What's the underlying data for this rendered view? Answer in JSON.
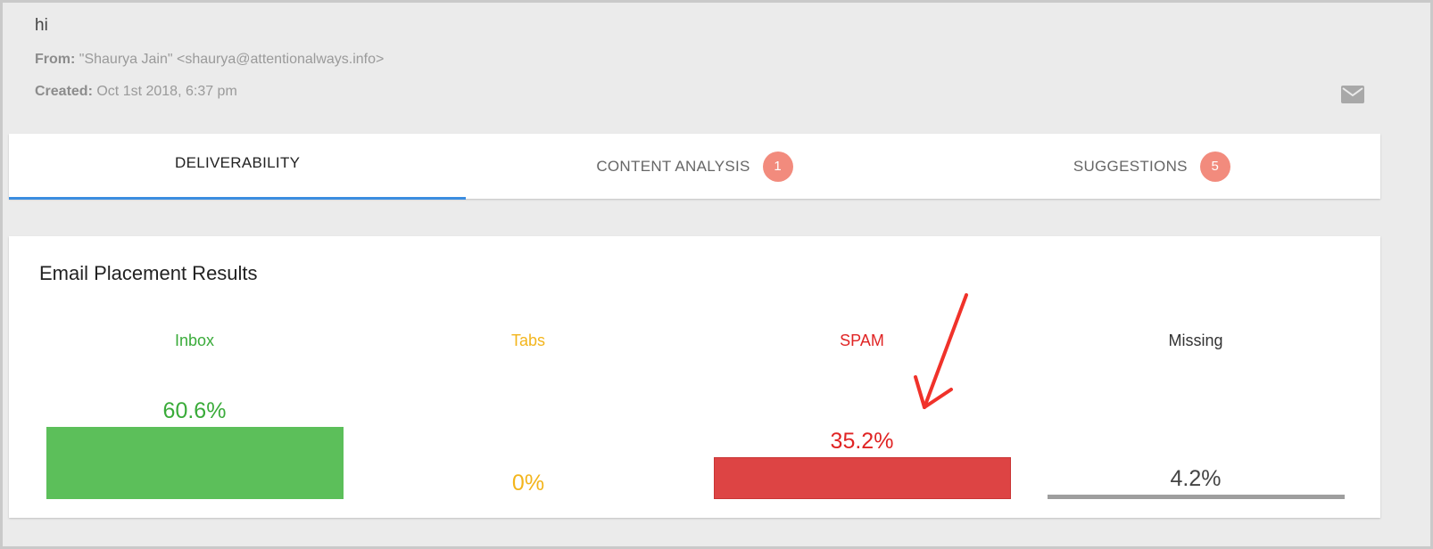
{
  "message": {
    "subject": "hi",
    "from_label": "From:",
    "from_value": "\"Shaurya Jain\" <shaurya@attentionalways.info>",
    "created_label": "Created:",
    "created_value": "Oct 1st 2018, 6:37 pm",
    "icon": "mail-icon"
  },
  "tabs": [
    {
      "label": "DELIVERABILITY",
      "badge": null,
      "active": true
    },
    {
      "label": "CONTENT ANALYSIS",
      "badge": "1",
      "active": false
    },
    {
      "label": "SUGGESTIONS",
      "badge": "5",
      "active": false
    }
  ],
  "results": {
    "title": "Email Placement Results",
    "columns": [
      {
        "label": "Inbox",
        "value_text": "60.6%",
        "percent": 60.6,
        "color": "#5cbf5a",
        "label_color": "#3aab3a"
      },
      {
        "label": "Tabs",
        "value_text": "0%",
        "percent": 0,
        "color": "#f3b51c",
        "label_color": "#f3b51c"
      },
      {
        "label": "SPAM",
        "value_text": "35.2%",
        "percent": 35.2,
        "color": "#dd4444",
        "label_color": "#e02424"
      },
      {
        "label": "Missing",
        "value_text": "4.2%",
        "percent": 4.2,
        "color": "#9e9e9e",
        "label_color": "#333333"
      }
    ]
  },
  "colors": {
    "tab_underline": "#3b8de0",
    "badge": "#f28b7d",
    "annotation_arrow": "#f0322a"
  }
}
